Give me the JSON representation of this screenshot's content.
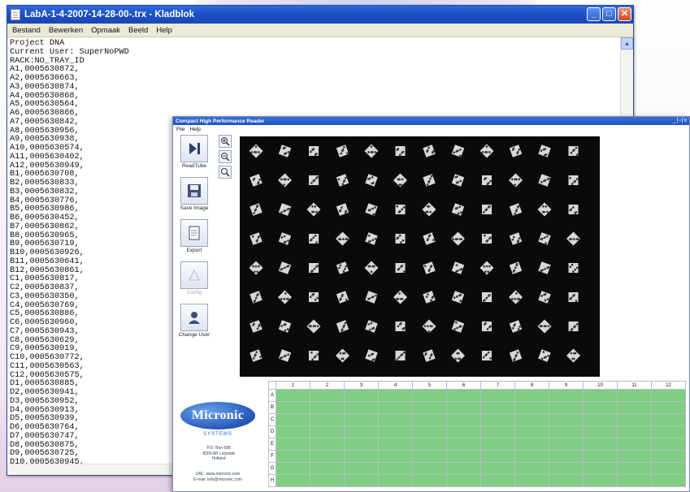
{
  "notepad": {
    "title": "LabA-1-4-2007-14-28-00-.trx - Kladblok",
    "menu": [
      "Bestand",
      "Bewerken",
      "Opmaak",
      "Beeld",
      "Help"
    ],
    "lines": [
      "Project DNA",
      "Current User: SuperNoPWD",
      "RACK:NO_TRAY_ID",
      "A1,0005630872,",
      "A2,0005630663,",
      "A3,0005630874,",
      "A4,0005630868,",
      "A5,0005630564,",
      "A6,0005630866,",
      "A7,0005630842,",
      "A8,0005630956,",
      "A9,0005630938,",
      "A10,0005630574,",
      "A11,0005630402,",
      "A12,0005630949,",
      "B1,0005630708,",
      "B2,0005630833,",
      "B3,0005630832,",
      "B4,0005630776,",
      "B5,0005630986,",
      "B6,0005630452,",
      "B7,0005630862,",
      "B8,0005630965,",
      "B9,0005630719,",
      "B10,0005630926,",
      "B11,0005630641,",
      "B12,0005630861,",
      "C1,0005630817,",
      "C2,0005630837,",
      "C3,0005630350,",
      "C4,0005630769,",
      "C5,0005630886,",
      "C6,0005630960,",
      "C7,0005630943,",
      "C8,0005630629,",
      "C9,0005630919,",
      "C10,0005630772,",
      "C11,0005630563,",
      "C12,0005630575,",
      "D1,0005630885,",
      "D2,0005630941,",
      "D3,0005630952,",
      "D4,0005630913,",
      "D5,0005630939,",
      "D6,0005630764,",
      "D7,0005630747,",
      "D8,0005630875,",
      "D9,0005630725,",
      "D10,0005630945,"
    ]
  },
  "reader": {
    "title": "Compact High Performance Reader",
    "menu": [
      "File",
      "Help"
    ],
    "tools": [
      {
        "label": "ReadTube"
      },
      {
        "label": "Save Image"
      },
      {
        "label": "Export"
      },
      {
        "label": "Config"
      },
      {
        "label": "Change User"
      }
    ],
    "logo": "Micronic",
    "logo_sub": "SYSTEMS",
    "address": [
      "P.O. Box 688",
      "8200 AR Lelystad",
      "Holland"
    ],
    "contact": [
      "URL: www.micronic.com",
      "E-mail: info@micronic.com"
    ],
    "grid": {
      "columns": [
        "1",
        "2",
        "3",
        "4",
        "5",
        "6",
        "7",
        "8",
        "9",
        "10",
        "11",
        "12"
      ],
      "rows": [
        "A",
        "B",
        "C",
        "D",
        "E",
        "F",
        "G",
        "H"
      ],
      "cell_color": "#7fce84"
    }
  },
  "colors": {
    "titlebar_blue": "#1b4fc4",
    "plate_background": "#0a0a0a",
    "grid_green": "#7fce84",
    "logo_blue": "#2556b8"
  }
}
